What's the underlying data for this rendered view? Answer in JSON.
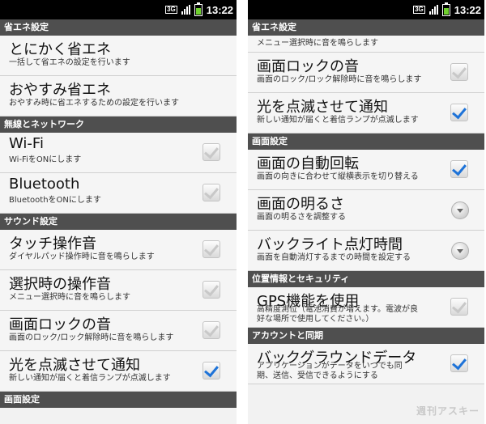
{
  "status": {
    "network": "3G",
    "time": "13:22"
  },
  "left": {
    "items": [
      {
        "kind": "section",
        "label": "省エネ設定"
      },
      {
        "kind": "item",
        "title": "とにかく省エネ",
        "summary": "一括して省エネの設定を行います"
      },
      {
        "kind": "item",
        "title": "おやすみ省エネ",
        "summary": "おやすみ時に省エネするための設定を行います"
      },
      {
        "kind": "section",
        "label": "無線とネットワーク"
      },
      {
        "kind": "item",
        "title": "Wi-Fi",
        "summary": "Wi-FiをONにします",
        "control": "checkbox",
        "checked": false
      },
      {
        "kind": "item",
        "title": "Bluetooth",
        "summary": "BluetoothをONにします",
        "control": "checkbox",
        "checked": false
      },
      {
        "kind": "section",
        "label": "サウンド設定"
      },
      {
        "kind": "item",
        "title": "タッチ操作音",
        "summary": "ダイヤルパッド操作時に音を鳴らします",
        "control": "checkbox",
        "checked": false
      },
      {
        "kind": "item",
        "title": "選択時の操作音",
        "summary": "メニュー選択時に音を鳴らします",
        "control": "checkbox",
        "checked": false
      },
      {
        "kind": "item",
        "title": "画面ロックの音",
        "summary": "画面のロック/ロック解除時に音を鳴らします",
        "control": "checkbox",
        "checked": false
      },
      {
        "kind": "item",
        "title": "光を点滅させて通知",
        "summary": "新しい通知が届くと着信ランプが点滅します",
        "control": "checkbox",
        "checked": true
      },
      {
        "kind": "section",
        "label": "画面設定"
      }
    ]
  },
  "right": {
    "items": [
      {
        "kind": "section",
        "label": "省エネ設定"
      },
      {
        "kind": "item",
        "cut": true,
        "summary": "メニュー選択時に音を鳴らします"
      },
      {
        "kind": "item",
        "title": "画面ロックの音",
        "summary": "画面のロック/ロック解除時に音を鳴らします",
        "control": "checkbox",
        "checked": false
      },
      {
        "kind": "item",
        "title": "光を点滅させて通知",
        "summary": "新しい通知が届くと着信ランプが点滅します",
        "control": "checkbox",
        "checked": true
      },
      {
        "kind": "section",
        "label": "画面設定"
      },
      {
        "kind": "item",
        "title": "画面の自動回転",
        "summary": "画面の向きに合わせて縦横表示を切り替える",
        "control": "checkbox",
        "checked": true
      },
      {
        "kind": "item",
        "title": "画面の明るさ",
        "summary": "画面の明るさを調整する",
        "control": "dropdown"
      },
      {
        "kind": "item",
        "title": "バックライト点灯時間",
        "summary": "画面を自動消灯するまでの時間を設定する",
        "control": "dropdown"
      },
      {
        "kind": "section",
        "label": "位置情報とセキュリティ"
      },
      {
        "kind": "item",
        "title": "GPS機能を使用",
        "summary": "高精度測位（電池消費が増えます。電波が良",
        "summary2": "好な場所で使用してください。）",
        "control": "checkbox",
        "checked": false
      },
      {
        "kind": "section",
        "label": "アカウントと同期"
      },
      {
        "kind": "item",
        "title": "バックグラウンドデータ",
        "summary": "アプリケーションがデータをいつでも同",
        "summary2": "期、送信、受信できるようにする",
        "control": "checkbox",
        "checked": true
      }
    ],
    "watermark": "週刊アスキー"
  }
}
